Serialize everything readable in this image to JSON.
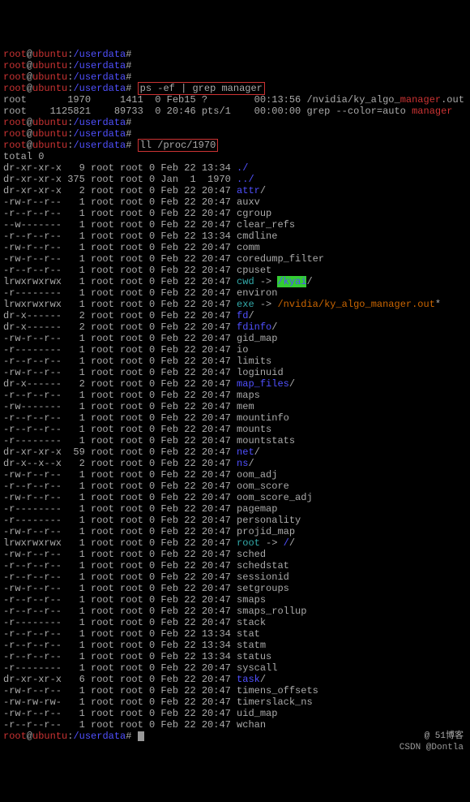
{
  "prompt": {
    "user": "root",
    "at": "@",
    "host": "ubuntu",
    "colon": ":",
    "path": "/userdata",
    "hash": "# "
  },
  "cmd1": "ps -ef | grep manager",
  "cmd2": "ll /proc/1970",
  "ps_out": {
    "line1": {
      "c1": "root",
      "c2": "       1970     1411  0 Feb15 ?        00:13:56 /nvidia/ky_algo_",
      "hl": "manager",
      "c3": ".out"
    },
    "line2": {
      "c1": "root",
      "c2": "    1125821    89733  0 20:46 pts/1    00:00:00 grep --color=auto ",
      "hl": "manager"
    }
  },
  "total": "total 0",
  "ll_entries": [
    {
      "perm": "dr-xr-xr-x",
      "lnk": "   9",
      "own": "root root",
      "sz": "0",
      "dt": "Feb 22 13:34",
      "name": "./",
      "cls": "blue"
    },
    {
      "perm": "dr-xr-xr-x",
      "lnk": " 375",
      "own": "root root",
      "sz": "0",
      "dt": "Jan  1  1970",
      "name": "../",
      "cls": "blue"
    },
    {
      "perm": "dr-xr-xr-x",
      "lnk": "   2",
      "own": "root root",
      "sz": "0",
      "dt": "Feb 22 20:47",
      "name": "attr",
      "suf": "/",
      "cls": "blue"
    },
    {
      "perm": "-rw-r--r--",
      "lnk": "   1",
      "own": "root root",
      "sz": "0",
      "dt": "Feb 22 20:47",
      "name": "auxv",
      "cls": ""
    },
    {
      "perm": "-r--r--r--",
      "lnk": "   1",
      "own": "root root",
      "sz": "0",
      "dt": "Feb 22 20:47",
      "name": "cgroup",
      "cls": ""
    },
    {
      "perm": "--w-------",
      "lnk": "   1",
      "own": "root root",
      "sz": "0",
      "dt": "Feb 22 20:47",
      "name": "clear_refs",
      "cls": ""
    },
    {
      "perm": "-r--r--r--",
      "lnk": "   1",
      "own": "root root",
      "sz": "0",
      "dt": "Feb 22 13:34",
      "name": "cmdline",
      "cls": ""
    },
    {
      "perm": "-rw-r--r--",
      "lnk": "   1",
      "own": "root root",
      "sz": "0",
      "dt": "Feb 22 20:47",
      "name": "comm",
      "cls": ""
    },
    {
      "perm": "-rw-r--r--",
      "lnk": "   1",
      "own": "root root",
      "sz": "0",
      "dt": "Feb 22 20:47",
      "name": "coredump_filter",
      "cls": ""
    },
    {
      "perm": "-r--r--r--",
      "lnk": "   1",
      "own": "root root",
      "sz": "0",
      "dt": "Feb 22 20:47",
      "name": "cpuset",
      "cls": ""
    },
    {
      "perm": "lrwxrwxrwx",
      "lnk": "   1",
      "own": "root root",
      "sz": "0",
      "dt": "Feb 22 20:47",
      "name": "cwd",
      "cls": "cyan",
      "arrow": " -> ",
      "tgt": "/kyai",
      "tcls": "green-bg",
      "suf": "/"
    },
    {
      "perm": "-r--------",
      "lnk": "   1",
      "own": "root root",
      "sz": "0",
      "dt": "Feb 22 20:47",
      "name": "environ",
      "cls": ""
    },
    {
      "perm": "lrwxrwxrwx",
      "lnk": "   1",
      "own": "root root",
      "sz": "0",
      "dt": "Feb 22 20:47",
      "name": "exe",
      "cls": "cyan",
      "arrow": " -> ",
      "tgt": "/nvidia/ky_algo_manager.out",
      "tcls": "orange",
      "suf": "*"
    },
    {
      "perm": "dr-x------",
      "lnk": "   2",
      "own": "root root",
      "sz": "0",
      "dt": "Feb 22 20:47",
      "name": "fd",
      "suf": "/",
      "cls": "blue"
    },
    {
      "perm": "dr-x------",
      "lnk": "   2",
      "own": "root root",
      "sz": "0",
      "dt": "Feb 22 20:47",
      "name": "fdinfo",
      "suf": "/",
      "cls": "blue"
    },
    {
      "perm": "-rw-r--r--",
      "lnk": "   1",
      "own": "root root",
      "sz": "0",
      "dt": "Feb 22 20:47",
      "name": "gid_map",
      "cls": ""
    },
    {
      "perm": "-r--------",
      "lnk": "   1",
      "own": "root root",
      "sz": "0",
      "dt": "Feb 22 20:47",
      "name": "io",
      "cls": ""
    },
    {
      "perm": "-r--r--r--",
      "lnk": "   1",
      "own": "root root",
      "sz": "0",
      "dt": "Feb 22 20:47",
      "name": "limits",
      "cls": ""
    },
    {
      "perm": "-rw-r--r--",
      "lnk": "   1",
      "own": "root root",
      "sz": "0",
      "dt": "Feb 22 20:47",
      "name": "loginuid",
      "cls": ""
    },
    {
      "perm": "dr-x------",
      "lnk": "   2",
      "own": "root root",
      "sz": "0",
      "dt": "Feb 22 20:47",
      "name": "map_files",
      "suf": "/",
      "cls": "blue"
    },
    {
      "perm": "-r--r--r--",
      "lnk": "   1",
      "own": "root root",
      "sz": "0",
      "dt": "Feb 22 20:47",
      "name": "maps",
      "cls": ""
    },
    {
      "perm": "-rw-------",
      "lnk": "   1",
      "own": "root root",
      "sz": "0",
      "dt": "Feb 22 20:47",
      "name": "mem",
      "cls": ""
    },
    {
      "perm": "-r--r--r--",
      "lnk": "   1",
      "own": "root root",
      "sz": "0",
      "dt": "Feb 22 20:47",
      "name": "mountinfo",
      "cls": ""
    },
    {
      "perm": "-r--r--r--",
      "lnk": "   1",
      "own": "root root",
      "sz": "0",
      "dt": "Feb 22 20:47",
      "name": "mounts",
      "cls": ""
    },
    {
      "perm": "-r--------",
      "lnk": "   1",
      "own": "root root",
      "sz": "0",
      "dt": "Feb 22 20:47",
      "name": "mountstats",
      "cls": ""
    },
    {
      "perm": "dr-xr-xr-x",
      "lnk": "  59",
      "own": "root root",
      "sz": "0",
      "dt": "Feb 22 20:47",
      "name": "net",
      "suf": "/",
      "cls": "blue"
    },
    {
      "perm": "dr-x--x--x",
      "lnk": "   2",
      "own": "root root",
      "sz": "0",
      "dt": "Feb 22 20:47",
      "name": "ns",
      "suf": "/",
      "cls": "blue"
    },
    {
      "perm": "-rw-r--r--",
      "lnk": "   1",
      "own": "root root",
      "sz": "0",
      "dt": "Feb 22 20:47",
      "name": "oom_adj",
      "cls": ""
    },
    {
      "perm": "-r--r--r--",
      "lnk": "   1",
      "own": "root root",
      "sz": "0",
      "dt": "Feb 22 20:47",
      "name": "oom_score",
      "cls": ""
    },
    {
      "perm": "-rw-r--r--",
      "lnk": "   1",
      "own": "root root",
      "sz": "0",
      "dt": "Feb 22 20:47",
      "name": "oom_score_adj",
      "cls": ""
    },
    {
      "perm": "-r--------",
      "lnk": "   1",
      "own": "root root",
      "sz": "0",
      "dt": "Feb 22 20:47",
      "name": "pagemap",
      "cls": ""
    },
    {
      "perm": "-r--------",
      "lnk": "   1",
      "own": "root root",
      "sz": "0",
      "dt": "Feb 22 20:47",
      "name": "personality",
      "cls": ""
    },
    {
      "perm": "-rw-r--r--",
      "lnk": "   1",
      "own": "root root",
      "sz": "0",
      "dt": "Feb 22 20:47",
      "name": "projid_map",
      "cls": ""
    },
    {
      "perm": "lrwxrwxrwx",
      "lnk": "   1",
      "own": "root root",
      "sz": "0",
      "dt": "Feb 22 20:47",
      "name": "root",
      "cls": "cyan",
      "arrow": " -> ",
      "tgt": "/",
      "tcls": "blue",
      "suf": "/"
    },
    {
      "perm": "-rw-r--r--",
      "lnk": "   1",
      "own": "root root",
      "sz": "0",
      "dt": "Feb 22 20:47",
      "name": "sched",
      "cls": ""
    },
    {
      "perm": "-r--r--r--",
      "lnk": "   1",
      "own": "root root",
      "sz": "0",
      "dt": "Feb 22 20:47",
      "name": "schedstat",
      "cls": ""
    },
    {
      "perm": "-r--r--r--",
      "lnk": "   1",
      "own": "root root",
      "sz": "0",
      "dt": "Feb 22 20:47",
      "name": "sessionid",
      "cls": ""
    },
    {
      "perm": "-rw-r--r--",
      "lnk": "   1",
      "own": "root root",
      "sz": "0",
      "dt": "Feb 22 20:47",
      "name": "setgroups",
      "cls": ""
    },
    {
      "perm": "-r--r--r--",
      "lnk": "   1",
      "own": "root root",
      "sz": "0",
      "dt": "Feb 22 20:47",
      "name": "smaps",
      "cls": ""
    },
    {
      "perm": "-r--r--r--",
      "lnk": "   1",
      "own": "root root",
      "sz": "0",
      "dt": "Feb 22 20:47",
      "name": "smaps_rollup",
      "cls": ""
    },
    {
      "perm": "-r--------",
      "lnk": "   1",
      "own": "root root",
      "sz": "0",
      "dt": "Feb 22 20:47",
      "name": "stack",
      "cls": ""
    },
    {
      "perm": "-r--r--r--",
      "lnk": "   1",
      "own": "root root",
      "sz": "0",
      "dt": "Feb 22 13:34",
      "name": "stat",
      "cls": ""
    },
    {
      "perm": "-r--r--r--",
      "lnk": "   1",
      "own": "root root",
      "sz": "0",
      "dt": "Feb 22 13:34",
      "name": "statm",
      "cls": ""
    },
    {
      "perm": "-r--r--r--",
      "lnk": "   1",
      "own": "root root",
      "sz": "0",
      "dt": "Feb 22 13:34",
      "name": "status",
      "cls": ""
    },
    {
      "perm": "-r--------",
      "lnk": "   1",
      "own": "root root",
      "sz": "0",
      "dt": "Feb 22 20:47",
      "name": "syscall",
      "cls": ""
    },
    {
      "perm": "dr-xr-xr-x",
      "lnk": "   6",
      "own": "root root",
      "sz": "0",
      "dt": "Feb 22 20:47",
      "name": "task",
      "suf": "/",
      "cls": "blue"
    },
    {
      "perm": "-rw-r--r--",
      "lnk": "   1",
      "own": "root root",
      "sz": "0",
      "dt": "Feb 22 20:47",
      "name": "timens_offsets",
      "cls": ""
    },
    {
      "perm": "-rw-rw-rw-",
      "lnk": "   1",
      "own": "root root",
      "sz": "0",
      "dt": "Feb 22 20:47",
      "name": "timerslack_ns",
      "cls": ""
    },
    {
      "perm": "-rw-r--r--",
      "lnk": "   1",
      "own": "root root",
      "sz": "0",
      "dt": "Feb 22 20:47",
      "name": "uid_map",
      "cls": ""
    },
    {
      "perm": "-r--r--r--",
      "lnk": "   1",
      "own": "root root",
      "sz": "0",
      "dt": "Feb 22 20:47",
      "name": "wchan",
      "cls": ""
    }
  ],
  "watermark_csdn": "CSDN @Dontla",
  "watermark_51": "@ 51博客"
}
